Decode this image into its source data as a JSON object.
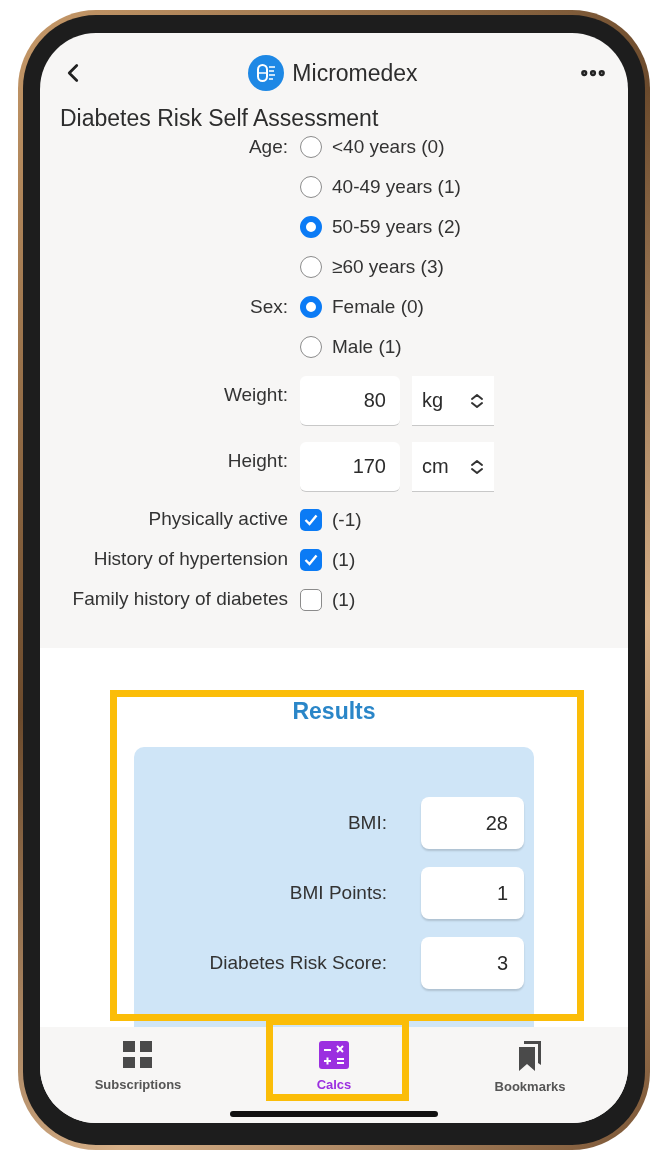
{
  "header": {
    "title": "Micromedex"
  },
  "page_title": "Diabetes Risk Self Assessment",
  "radio_groups": [
    {
      "label": "Age:",
      "options": [
        {
          "label": "<40 years (0)",
          "selected": false
        },
        {
          "label": "40-49 years (1)",
          "selected": false
        },
        {
          "label": "50-59 years (2)",
          "selected": true
        },
        {
          "label": "≥60 years (3)",
          "selected": false
        }
      ]
    },
    {
      "label": "Sex:",
      "options": [
        {
          "label": "Female (0)",
          "selected": true
        },
        {
          "label": "Male (1)",
          "selected": false
        }
      ]
    }
  ],
  "measurements": [
    {
      "label": "Weight:",
      "value": "80",
      "unit": "kg"
    },
    {
      "label": "Height:",
      "value": "170",
      "unit": "cm"
    }
  ],
  "checkboxes": [
    {
      "label": "Physically active",
      "checked": true,
      "points": "(-1)"
    },
    {
      "label": "History of hypertension",
      "checked": true,
      "points": "(1)"
    },
    {
      "label": "Family history of diabetes",
      "checked": false,
      "points": "(1)"
    }
  ],
  "results": {
    "title": "Results",
    "rows": [
      {
        "label": "BMI:",
        "value": "28"
      },
      {
        "label": "BMI Points:",
        "value": "1"
      },
      {
        "label": "Diabetes Risk Score:",
        "value": "3"
      }
    ]
  },
  "tab_bar": [
    {
      "label": "Subscriptions",
      "selected": false,
      "kind": "grid"
    },
    {
      "label": "Calcs",
      "selected": true,
      "kind": "calculator"
    },
    {
      "label": "Bookmarks",
      "selected": false,
      "kind": "bookmarks"
    }
  ]
}
